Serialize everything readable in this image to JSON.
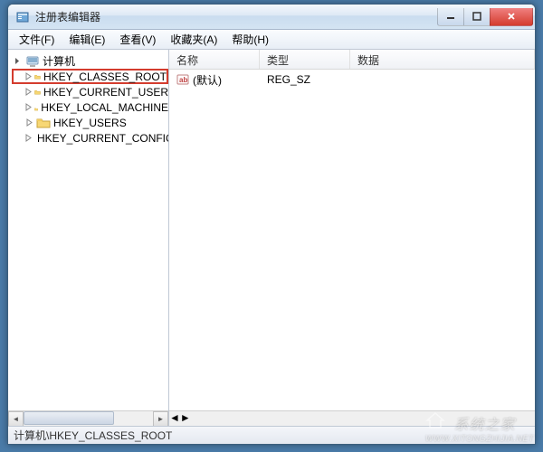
{
  "window": {
    "title": "注册表编辑器"
  },
  "menu": {
    "file": "文件(F)",
    "edit": "编辑(E)",
    "view": "查看(V)",
    "favorites": "收藏夹(A)",
    "help": "帮助(H)"
  },
  "tree": {
    "root": "计算机",
    "items": [
      {
        "label": "HKEY_CLASSES_ROOT",
        "selected": true
      },
      {
        "label": "HKEY_CURRENT_USER",
        "selected": false
      },
      {
        "label": "HKEY_LOCAL_MACHINE",
        "selected": false
      },
      {
        "label": "HKEY_USERS",
        "selected": false
      },
      {
        "label": "HKEY_CURRENT_CONFIG",
        "selected": false
      }
    ]
  },
  "list": {
    "columns": {
      "name": "名称",
      "type": "类型",
      "data": "数据"
    },
    "rows": [
      {
        "name": "(默认)",
        "type": "REG_SZ",
        "data": ""
      }
    ]
  },
  "statusbar": {
    "path": "计算机\\HKEY_CLASSES_ROOT"
  },
  "watermark": {
    "text": "系统之家",
    "url": "WWW.XITONGZHIJIA.NET"
  }
}
